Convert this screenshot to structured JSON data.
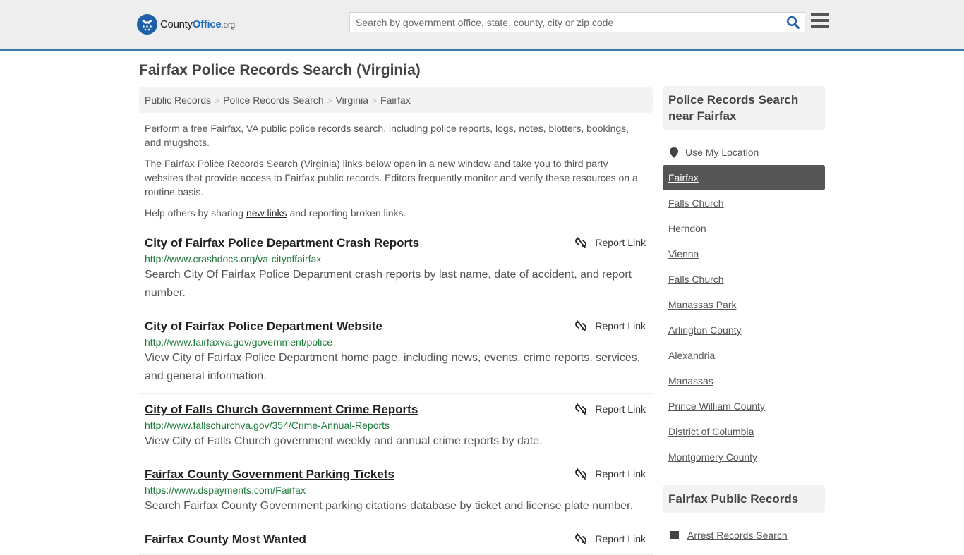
{
  "header": {
    "logo": {
      "name_part1": "County",
      "name_part2": "Office",
      "tld": ".org"
    },
    "search": {
      "placeholder": "Search by government office, state, county, city or zip code",
      "value": ""
    },
    "colors": {
      "brand_blue": "#1f5ea8",
      "header_border": "#3a7cb1",
      "header_bg": "#eeeeee"
    }
  },
  "page": {
    "title": "Fairfax Police Records Search (Virginia)"
  },
  "breadcrumb": [
    {
      "label": "Public Records"
    },
    {
      "label": "Police Records Search"
    },
    {
      "label": "Virginia"
    },
    {
      "label": "Fairfax"
    }
  ],
  "intro": {
    "p1": "Perform a free Fairfax, VA public police records search, including police reports, logs, notes, blotters, bookings, and mugshots.",
    "p2": "The Fairfax Police Records Search (Virginia) links below open in a new window and take you to third party websites that provide access to Fairfax public records. Editors frequently monitor and verify these resources on a routine basis.",
    "p3_before": "Help others by sharing ",
    "p3_link": "new links",
    "p3_after": " and reporting broken links."
  },
  "results": [
    {
      "title": "City of Fairfax Police Department Crash Reports",
      "url": "http://www.crashdocs.org/va-cityoffairfax",
      "description": "Search City Of Fairfax Police Department crash reports by last name, date of accident, and report number.",
      "report_label": "Report Link"
    },
    {
      "title": "City of Fairfax Police Department Website",
      "url": "http://www.fairfaxva.gov/government/police",
      "description": "View City of Fairfax Police Department home page, including news, events, crime reports, services, and general information.",
      "report_label": "Report Link"
    },
    {
      "title": "City of Falls Church Government Crime Reports",
      "url": "http://www.fallschurchva.gov/354/Crime-Annual-Reports",
      "description": "View City of Falls Church government weekly and annual crime reports by date.",
      "report_label": "Report Link"
    },
    {
      "title": "Fairfax County Government Parking Tickets",
      "url": "https://www.dspayments.com/Fairfax",
      "description": "Search Fairfax County Government parking citations database by ticket and license plate number.",
      "report_label": "Report Link"
    },
    {
      "title": "Fairfax County Most Wanted",
      "url": "",
      "description": "",
      "report_label": "Report Link"
    }
  ],
  "sidebar": {
    "nearby_heading": "Police Records Search near Fairfax",
    "use_location": "Use My Location",
    "nearby": [
      {
        "label": "Fairfax",
        "active": true
      },
      {
        "label": "Falls Church"
      },
      {
        "label": "Herndon"
      },
      {
        "label": "Vienna"
      },
      {
        "label": "Falls Church"
      },
      {
        "label": "Manassas Park"
      },
      {
        "label": "Arlington County"
      },
      {
        "label": "Alexandria"
      },
      {
        "label": "Manassas"
      },
      {
        "label": "Prince William County"
      },
      {
        "label": "District of Columbia"
      },
      {
        "label": "Montgomery County"
      }
    ],
    "public_records_heading": "Fairfax Public Records",
    "public_records": [
      {
        "label": "Arrest Records Search"
      }
    ]
  }
}
